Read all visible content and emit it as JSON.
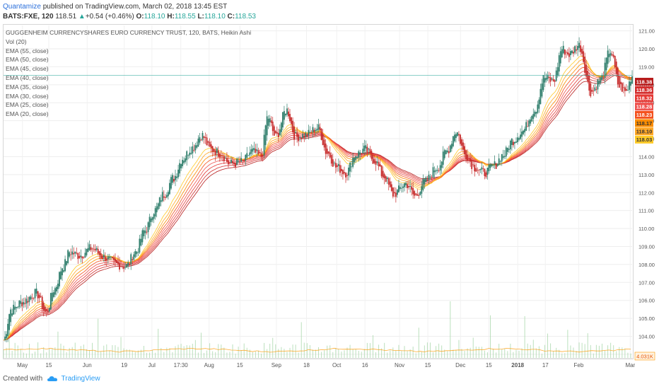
{
  "header": {
    "publisher": "Quantamize",
    "published_text": "published on TradingView.com, March 02, 2018 13:45 EST",
    "symbol": "BATS:FXE, 120",
    "last": "118.51",
    "change_arrow": "▲",
    "change": "+0.54 (+0.46%)",
    "o_label": "O:",
    "o": "118.10",
    "h_label": "H:",
    "h": "118.55",
    "l_label": "L:",
    "l": "118.10",
    "c_label": "C:",
    "c": "118.53"
  },
  "legend": {
    "title": "GUGGENHEIM CURRENCYSHARES EURO CURRENCY TRUST, 120, BATS, Heikin Ashi",
    "items": [
      "Vol (20)",
      "EMA (55, close)",
      "EMA (50, close)",
      "EMA (45, close)",
      "EMA (40, close)",
      "EMA (35, close)",
      "EMA (30, close)",
      "EMA (25, close)",
      "EMA (20, close)"
    ]
  },
  "footer": {
    "created_with": "Created with",
    "brand": "TradingView"
  },
  "colors": {
    "up_candle": "#26a69a",
    "down_candle": "#ef5350",
    "price_line": "#26a69a",
    "volume": "#a5d6a7"
  },
  "chart_data": {
    "type": "candlestick",
    "chart_style": "Heikin Ashi",
    "ylim": [
      102.8,
      121.3
    ],
    "y_ticks": [
      103.0,
      104.0,
      105.0,
      106.0,
      107.0,
      108.0,
      109.0,
      110.0,
      111.0,
      112.0,
      113.0,
      114.0,
      115.0,
      116.0,
      117.0,
      118.0,
      119.0,
      120.0,
      121.0
    ],
    "y_tick_labels": [
      "103.00",
      "104.00",
      "105.00",
      "106.00",
      "107.00",
      "108.00",
      "109.00",
      "110.00",
      "111.00",
      "112.00",
      "113.00",
      "114.00",
      "115.00",
      "116.00",
      "117.00",
      "118.00",
      "119.00",
      "120.00",
      "121.00"
    ],
    "x_ticks": [
      {
        "label": "May",
        "pos": 0.03
      },
      {
        "label": "15",
        "pos": 0.072
      },
      {
        "label": "Jun",
        "pos": 0.133
      },
      {
        "label": "19",
        "pos": 0.192
      },
      {
        "label": "Jul",
        "pos": 0.236
      },
      {
        "label": "17:30",
        "pos": 0.282
      },
      {
        "label": "Aug",
        "pos": 0.327
      },
      {
        "label": "15",
        "pos": 0.376
      },
      {
        "label": "Sep",
        "pos": 0.434
      },
      {
        "label": "18",
        "pos": 0.482
      },
      {
        "label": "Oct",
        "pos": 0.53
      },
      {
        "label": "16",
        "pos": 0.575
      },
      {
        "label": "Nov",
        "pos": 0.63
      },
      {
        "label": "15",
        "pos": 0.675
      },
      {
        "label": "Dec",
        "pos": 0.727
      },
      {
        "label": "15",
        "pos": 0.772
      },
      {
        "label": "2018",
        "pos": 0.818
      },
      {
        "label": "17",
        "pos": 0.862
      },
      {
        "label": "Feb",
        "pos": 0.915
      },
      {
        "label": "Mar",
        "pos": 0.997
      }
    ],
    "price_path": [
      [
        0.0,
        103.8
      ],
      [
        0.012,
        105.5
      ],
      [
        0.03,
        105.9
      ],
      [
        0.052,
        106.4
      ],
      [
        0.068,
        105.3
      ],
      [
        0.08,
        106.6
      ],
      [
        0.095,
        107.9
      ],
      [
        0.105,
        108.7
      ],
      [
        0.12,
        108.5
      ],
      [
        0.14,
        108.9
      ],
      [
        0.16,
        108.4
      ],
      [
        0.18,
        108.0
      ],
      [
        0.195,
        107.9
      ],
      [
        0.21,
        108.7
      ],
      [
        0.225,
        109.9
      ],
      [
        0.24,
        111.0
      ],
      [
        0.255,
        111.9
      ],
      [
        0.27,
        112.8
      ],
      [
        0.285,
        113.9
      ],
      [
        0.3,
        114.5
      ],
      [
        0.315,
        115.2
      ],
      [
        0.33,
        114.4
      ],
      [
        0.345,
        114.2
      ],
      [
        0.36,
        113.6
      ],
      [
        0.38,
        113.7
      ],
      [
        0.395,
        114.3
      ],
      [
        0.41,
        114.0
      ],
      [
        0.42,
        116.2
      ],
      [
        0.433,
        115.1
      ],
      [
        0.45,
        116.6
      ],
      [
        0.465,
        115.1
      ],
      [
        0.48,
        115.2
      ],
      [
        0.5,
        115.6
      ],
      [
        0.515,
        114.2
      ],
      [
        0.53,
        113.4
      ],
      [
        0.545,
        113.1
      ],
      [
        0.56,
        114.1
      ],
      [
        0.575,
        114.4
      ],
      [
        0.59,
        113.8
      ],
      [
        0.605,
        112.9
      ],
      [
        0.62,
        111.9
      ],
      [
        0.64,
        112.5
      ],
      [
        0.655,
        111.8
      ],
      [
        0.67,
        112.6
      ],
      [
        0.69,
        113.4
      ],
      [
        0.705,
        114.3
      ],
      [
        0.72,
        115.4
      ],
      [
        0.735,
        114.1
      ],
      [
        0.75,
        113.4
      ],
      [
        0.765,
        113.1
      ],
      [
        0.78,
        113.5
      ],
      [
        0.795,
        114.1
      ],
      [
        0.81,
        114.9
      ],
      [
        0.825,
        115.4
      ],
      [
        0.845,
        116.6
      ],
      [
        0.86,
        118.4
      ],
      [
        0.875,
        118.2
      ],
      [
        0.888,
        120.0
      ],
      [
        0.9,
        119.7
      ],
      [
        0.915,
        120.2
      ],
      [
        0.935,
        117.6
      ],
      [
        0.95,
        118.3
      ],
      [
        0.965,
        119.9
      ],
      [
        0.98,
        117.9
      ],
      [
        0.99,
        117.6
      ],
      [
        1.0,
        118.5
      ]
    ],
    "ema_series": [
      {
        "period": 55,
        "color": "#b71c1c"
      },
      {
        "period": 50,
        "color": "#d32f2f"
      },
      {
        "period": 45,
        "color": "#e53935"
      },
      {
        "period": 40,
        "color": "#ef5350"
      },
      {
        "period": 35,
        "color": "#f4511e"
      },
      {
        "period": 30,
        "color": "#fb8c00"
      },
      {
        "period": 25,
        "color": "#ffa726"
      },
      {
        "period": 20,
        "color": "#ffca28"
      }
    ],
    "price_scale_labels": [
      {
        "value": "118.38",
        "color": "#b71c1c"
      },
      {
        "value": "118.36",
        "color": "#d32f2f"
      },
      {
        "value": "118.32",
        "color": "#e53935"
      },
      {
        "value": "118.28",
        "color": "#ef5350"
      },
      {
        "value": "118.23",
        "color": "#f4511e"
      },
      {
        "value": "118.17",
        "color": "#fb8c00"
      },
      {
        "value": "118.10",
        "color": "#ffa726"
      },
      {
        "value": "118.03",
        "color": "#ffca28"
      }
    ],
    "volume_label": "4.031K",
    "last_price_line": 118.53
  }
}
